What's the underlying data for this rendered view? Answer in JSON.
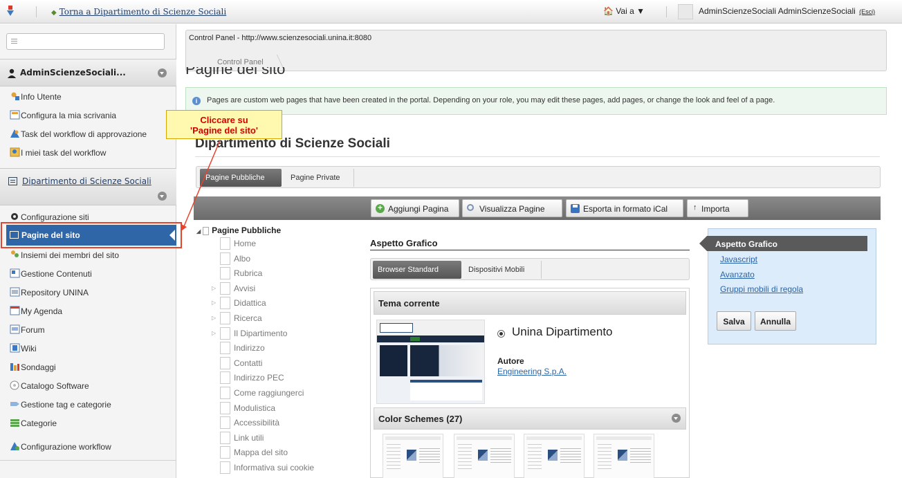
{
  "dockbar": {
    "back_link": "Torna a Dipartimento di Scienze Sociali",
    "goto_label": "🏠 Vai a ▼",
    "user_name": "AdminScienzeSociali AdminScienzeSociali",
    "exit_label": "(Esci)"
  },
  "leftpanel": {
    "user_section": "AdminScienzeSociali...",
    "user_items": [
      {
        "label": "Info Utente",
        "icon": "user-info-icon"
      },
      {
        "label": "Configura la mia scrivania",
        "icon": "desk-config-icon"
      },
      {
        "label": "Task del workflow di approvazione",
        "icon": "workflow-task-icon"
      },
      {
        "label": "I miei task del workflow",
        "icon": "my-tasks-icon"
      }
    ],
    "site_section": "Dipartimento di Scienze Sociali",
    "site_items": [
      {
        "label": "Configurazione siti",
        "icon": "gear-icon"
      },
      {
        "label": "Pagine del sito",
        "icon": "pages-icon",
        "selected": true
      },
      {
        "label": "Insiemi dei membri del sito",
        "icon": "members-icon"
      },
      {
        "label": "Gestione Contenuti",
        "icon": "content-icon"
      },
      {
        "label": "Repository UNINA",
        "icon": "repository-icon"
      },
      {
        "label": "My Agenda",
        "icon": "calendar-icon"
      },
      {
        "label": "Forum",
        "icon": "forum-icon"
      },
      {
        "label": "Wiki",
        "icon": "wiki-icon"
      },
      {
        "label": "Sondaggi",
        "icon": "poll-icon"
      },
      {
        "label": "Catalogo Software",
        "icon": "software-catalog-icon"
      },
      {
        "label": "Gestione tag e categorie",
        "icon": "tag-icon"
      },
      {
        "label": "Categorie",
        "icon": "categories-icon"
      },
      {
        "label": "Configurazione workflow",
        "icon": "workflow-config-icon"
      }
    ]
  },
  "annotation": {
    "line1": "Cliccare su",
    "line2": "'Pagine del sito'"
  },
  "main": {
    "cp_url": "Control Panel - http://www.scienzesociali.unina.it:8080",
    "breadcrumb": "Control Panel",
    "page_title": "Pagine del sito",
    "info_text": "Pages are custom web pages that have been created in the portal. Depending on your role, you may edit these pages, add pages, or change the look and feel of a page.",
    "site_title": "Dipartimento di Scienze Sociali",
    "tabs": [
      "Pagine Pubbliche",
      "Pagine Private"
    ],
    "toolbar": {
      "add_page": "Aggiungi Pagina",
      "view_pages": "Visualizza Pagine",
      "export": "Esporta in formato iCal",
      "import": "Importa",
      "import_arrow": "↑"
    },
    "tree": {
      "root": "Pagine Pubbliche",
      "nodes": [
        {
          "label": "Home",
          "expandable": false
        },
        {
          "label": "Albo",
          "expandable": false
        },
        {
          "label": "Rubrica",
          "expandable": false
        },
        {
          "label": "Avvisi",
          "expandable": true
        },
        {
          "label": "Didattica",
          "expandable": true
        },
        {
          "label": "Ricerca",
          "expandable": true
        },
        {
          "label": "Il Dipartimento",
          "expandable": true
        },
        {
          "label": "Indirizzo",
          "expandable": false
        },
        {
          "label": "Contatti",
          "expandable": false
        },
        {
          "label": "Indirizzo PEC",
          "expandable": false
        },
        {
          "label": "Come raggiungerci",
          "expandable": false
        },
        {
          "label": "Modulistica",
          "expandable": false
        },
        {
          "label": "Accessibilità",
          "expandable": false
        },
        {
          "label": "Link utili",
          "expandable": false
        },
        {
          "label": "Mappa del sito",
          "expandable": false
        },
        {
          "label": "Informativa sui cookie",
          "expandable": false
        }
      ]
    },
    "look_feel": {
      "title": "Aspetto Grafico",
      "subtabs": [
        "Browser Standard",
        "Dispositivi Mobili"
      ],
      "current_theme_label": "Tema corrente",
      "theme_name": "Unina Dipartimento",
      "author_label": "Autore",
      "author_name": "Engineering S.p.A.",
      "color_schemes_label": "Color Schemes (27)"
    },
    "settings": {
      "selected": "Aspetto Grafico",
      "links": [
        "Javascript",
        "Avanzato",
        "Gruppi mobili di regola"
      ],
      "save": "Salva",
      "cancel": "Annulla"
    }
  },
  "colors": {
    "selected_nav": "#2f66a8",
    "annotation_red": "#e8432c",
    "toolbar_gray": "#6b6b6b",
    "settings_bg": "#dcecfb"
  }
}
